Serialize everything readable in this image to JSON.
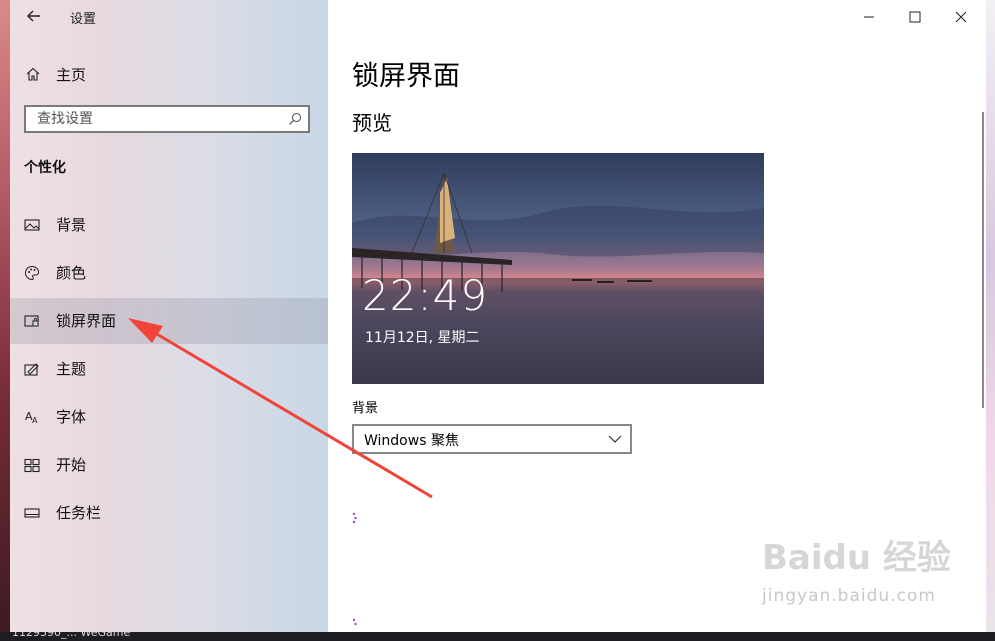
{
  "window": {
    "app_title": "设置",
    "controls": [
      "minimize-icon",
      "maximize-icon",
      "close-icon"
    ]
  },
  "sidebar": {
    "home_label": "主页",
    "search_placeholder": "查找设置",
    "section_title": "个性化",
    "items": [
      {
        "label": "背景",
        "icon": "picture-icon",
        "selected": false
      },
      {
        "label": "颜色",
        "icon": "palette-icon",
        "selected": false
      },
      {
        "label": "锁屏界面",
        "icon": "lock-screen-icon",
        "selected": true
      },
      {
        "label": "主题",
        "icon": "theme-icon",
        "selected": false
      },
      {
        "label": "字体",
        "icon": "font-icon",
        "selected": false
      },
      {
        "label": "开始",
        "icon": "start-icon",
        "selected": false
      },
      {
        "label": "任务栏",
        "icon": "taskbar-icon",
        "selected": false
      }
    ]
  },
  "main": {
    "page_title": "锁屏界面",
    "preview_heading": "预览",
    "preview_time": "22:49",
    "preview_date": "11月12日, 星期二",
    "background_label": "背景",
    "background_value": "Windows 聚焦"
  },
  "taskbar": {
    "text": "1129390_...  WeGame"
  },
  "watermark": {
    "main": "Baidu 经验",
    "sub": "jingyan.baidu.com"
  },
  "colors": {
    "accent_arrow": "#f0443a",
    "selected_bg": "#c9c6d0"
  }
}
